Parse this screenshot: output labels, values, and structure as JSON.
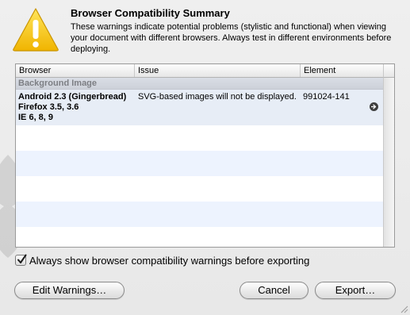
{
  "dialog": {
    "title": "Browser Compatibility Summary",
    "description": "These warnings indicate potential problems (stylistic and functional) when viewing your document with different browsers.  Always test in different environments before deploying."
  },
  "table": {
    "columns": [
      "Browser",
      "Issue",
      "Element"
    ],
    "group": "Background Image",
    "rows": [
      {
        "browsers": [
          "Android 2.3 (Gingerbread)",
          "Firefox 3.5, 3.6",
          "IE 6, 8, 9"
        ],
        "issue": "SVG-based images will not be displayed.",
        "element": "991024-141"
      }
    ]
  },
  "checkbox": {
    "label": "Always show browser compatibility warnings before exporting",
    "checked": true
  },
  "buttons": {
    "edit": "Edit Warnings…",
    "cancel": "Cancel",
    "export": "Export…"
  },
  "colors": {
    "warning_yellow": "#f5c400",
    "row_highlight": "#e7edf6",
    "group_header": "#d2d6de"
  }
}
